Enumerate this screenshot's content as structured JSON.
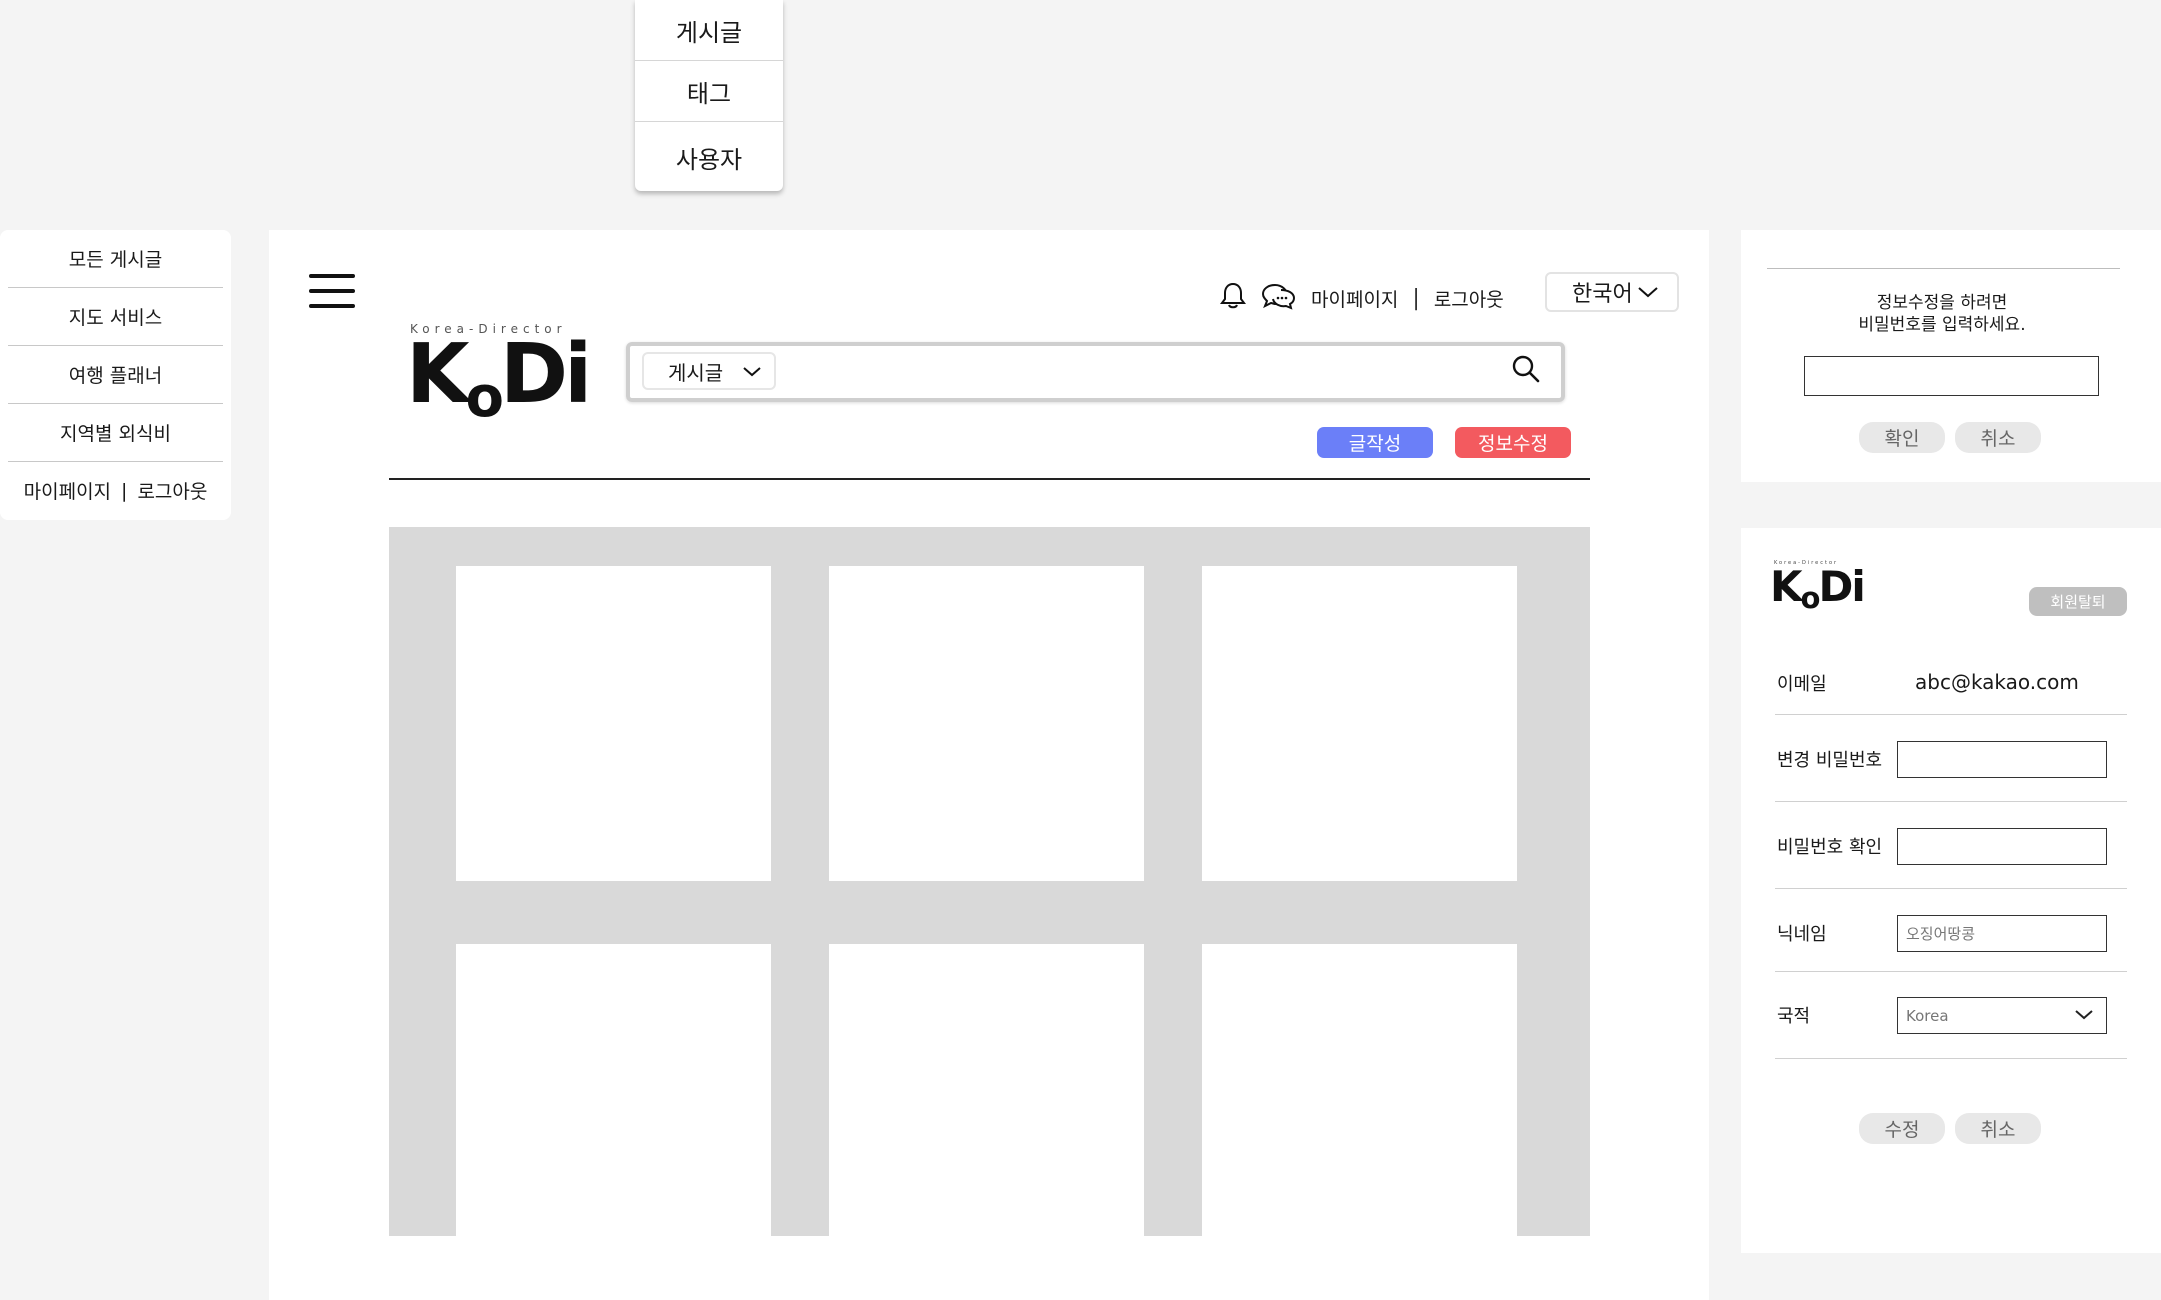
{
  "dropdown": {
    "items": [
      "게시글",
      "태그",
      "사용자"
    ]
  },
  "side_menu": {
    "items": [
      "모든 게시글",
      "지도 서비스",
      "여행 플래너",
      "지역별 외식비"
    ],
    "mypage": "마이페이지",
    "logout": "로그아웃",
    "separator": "|"
  },
  "header": {
    "logo_sub": "Korea-Director",
    "logo_k": "K",
    "logo_o": "o",
    "logo_di": "Di",
    "mypage": "마이페이지",
    "separator": "|",
    "logout": "로그아웃",
    "language": "한국어",
    "icons": [
      "hamburger-menu-icon",
      "bell-icon",
      "chat-icon",
      "search-icon",
      "chevron-down-icon"
    ]
  },
  "search": {
    "category": "게시글"
  },
  "buttons": {
    "write": "글작성",
    "edit_info": "정보수정"
  },
  "password_check": {
    "message_line1": "정보수정을 하려면",
    "message_line2": "비밀번호를 입력하세요.",
    "confirm": "확인",
    "cancel": "취소"
  },
  "profile": {
    "withdraw": "회원탈퇴",
    "email_label": "이메일",
    "email_value": "abc@kakao.com",
    "new_password_label": "변경 비밀번호",
    "confirm_password_label": "비밀번호 확인",
    "nickname_label": "닉네임",
    "nickname_placeholder": "오징어땅콩",
    "nationality_label": "국적",
    "nationality_value": "Korea",
    "submit": "수정",
    "cancel": "취소"
  },
  "colors": {
    "write_button": "#6b7ff8",
    "edit_button": "#f35a5f",
    "grid_background": "#d9d9d9",
    "page_background": "#f4f4f4"
  }
}
